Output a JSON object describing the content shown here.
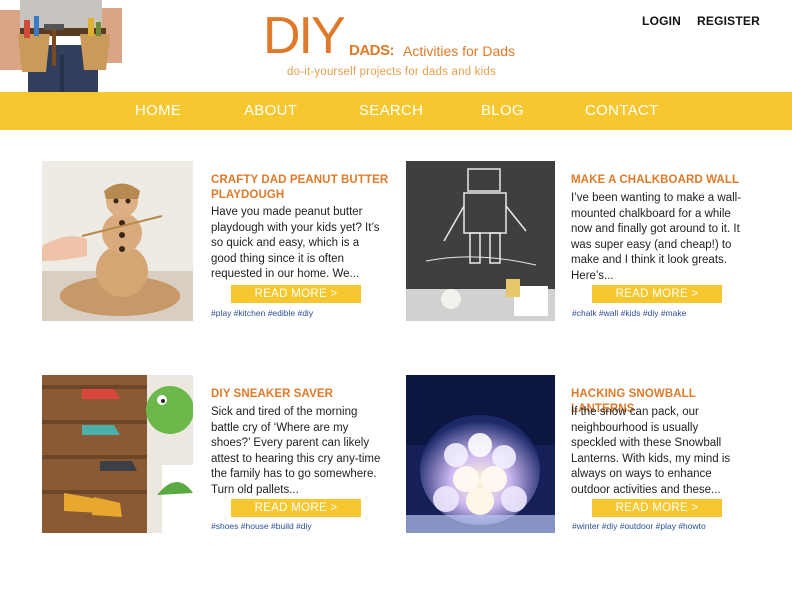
{
  "header": {
    "logo_big": "DIY",
    "logo_dads": "DADS:",
    "logo_sub": "Activities for Dads",
    "tagline": "do-it-yourself projects for dads and kids",
    "login": "LOGIN",
    "register": "REGISTER"
  },
  "nav": {
    "items": [
      {
        "label": "HOME"
      },
      {
        "label": "ABOUT"
      },
      {
        "label": "SEARCH"
      },
      {
        "label": "BLOG"
      },
      {
        "label": "CONTACT"
      }
    ]
  },
  "posts": [
    {
      "title": "CRAFTY DAD PEANUT BUTTER PLAYDOUGH",
      "excerpt": "Have you made peanut butter playdough with your kids yet? It’s so quick and easy, which is a good thing since it is often requested in our home. We...",
      "button": "READ MORE >",
      "tags": "#play #kitchen #edible #diy",
      "image": "playdough-snowman-photo"
    },
    {
      "title": "MAKE A CHALKBOARD WALL",
      "excerpt": "I’ve been wanting to make a wall-mounted chalkboard for a while now and finally got around to it. It was super easy (and cheap!) to make and I think it look greats. Here’s...",
      "button": "READ MORE >",
      "tags": "#chalk #wall #kids #diy #make",
      "image": "chalkboard-robot-photo"
    },
    {
      "title": "DIY SNEAKER SAVER",
      "excerpt": "Sick and tired of the morning battle cry of ‘Where are my shoes?’ Every parent can likely attest to hearing this cry any-time the family has to go somewhere. Turn old pallets...",
      "button": "READ MORE >",
      "tags": "#shoes #house #build #diy",
      "image": "pallet-shoe-rack-photo"
    },
    {
      "title": "HACKING SNOWBALL LANTERNS",
      "excerpt": "If the snow can pack, our neighbourhood is usually speckled with these Snowball Lanterns. With kids, my mind is always on ways to enhance outdoor activities and these...",
      "button": "READ MORE >",
      "tags": "#winter #diy #outdoor #play #howto",
      "image": "snowball-lantern-photo"
    }
  ],
  "colors": {
    "accent": "#e07a2a",
    "nav_bg": "#f6c72e",
    "tag_link": "#2b4f9a"
  }
}
